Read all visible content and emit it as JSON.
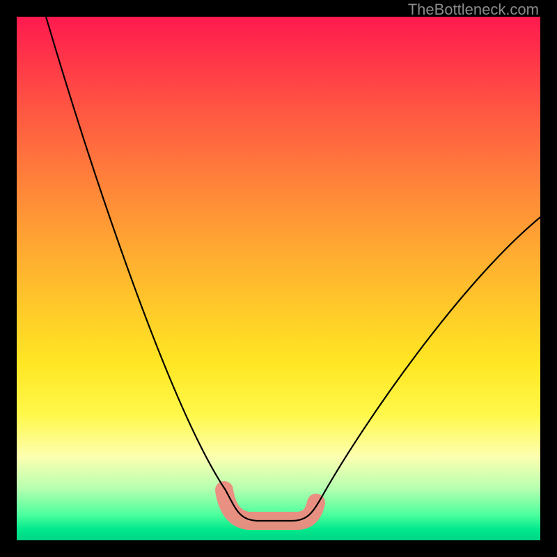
{
  "watermark": {
    "text": "TheBottleneck.com"
  },
  "colors": {
    "gradient_top": "#ff1a4f",
    "gradient_mid": "#ffe623",
    "gradient_bottom": "#00d486",
    "highlight": "#ef8a80",
    "curve": "#000000",
    "frame": "#000000"
  },
  "chart_data": {
    "type": "line",
    "title": "",
    "xlabel": "",
    "ylabel": "",
    "xlim": [
      0,
      100
    ],
    "ylim": [
      0,
      100
    ],
    "grid": false,
    "legend": false,
    "series": [
      {
        "name": "bottleneck-curve",
        "x": [
          5,
          10,
          15,
          20,
          25,
          30,
          35,
          40,
          42,
          45,
          48,
          50,
          52,
          55,
          60,
          65,
          70,
          75,
          80,
          85,
          90,
          95,
          100
        ],
        "y": [
          100,
          88,
          76,
          64,
          52,
          40,
          28,
          14,
          9,
          5,
          3,
          3,
          3,
          4,
          7,
          12,
          18,
          24,
          31,
          38,
          46,
          54,
          62
        ]
      }
    ],
    "optimal_region": {
      "x_start": 40,
      "x_end": 57,
      "y_level": 3
    },
    "annotations": []
  }
}
